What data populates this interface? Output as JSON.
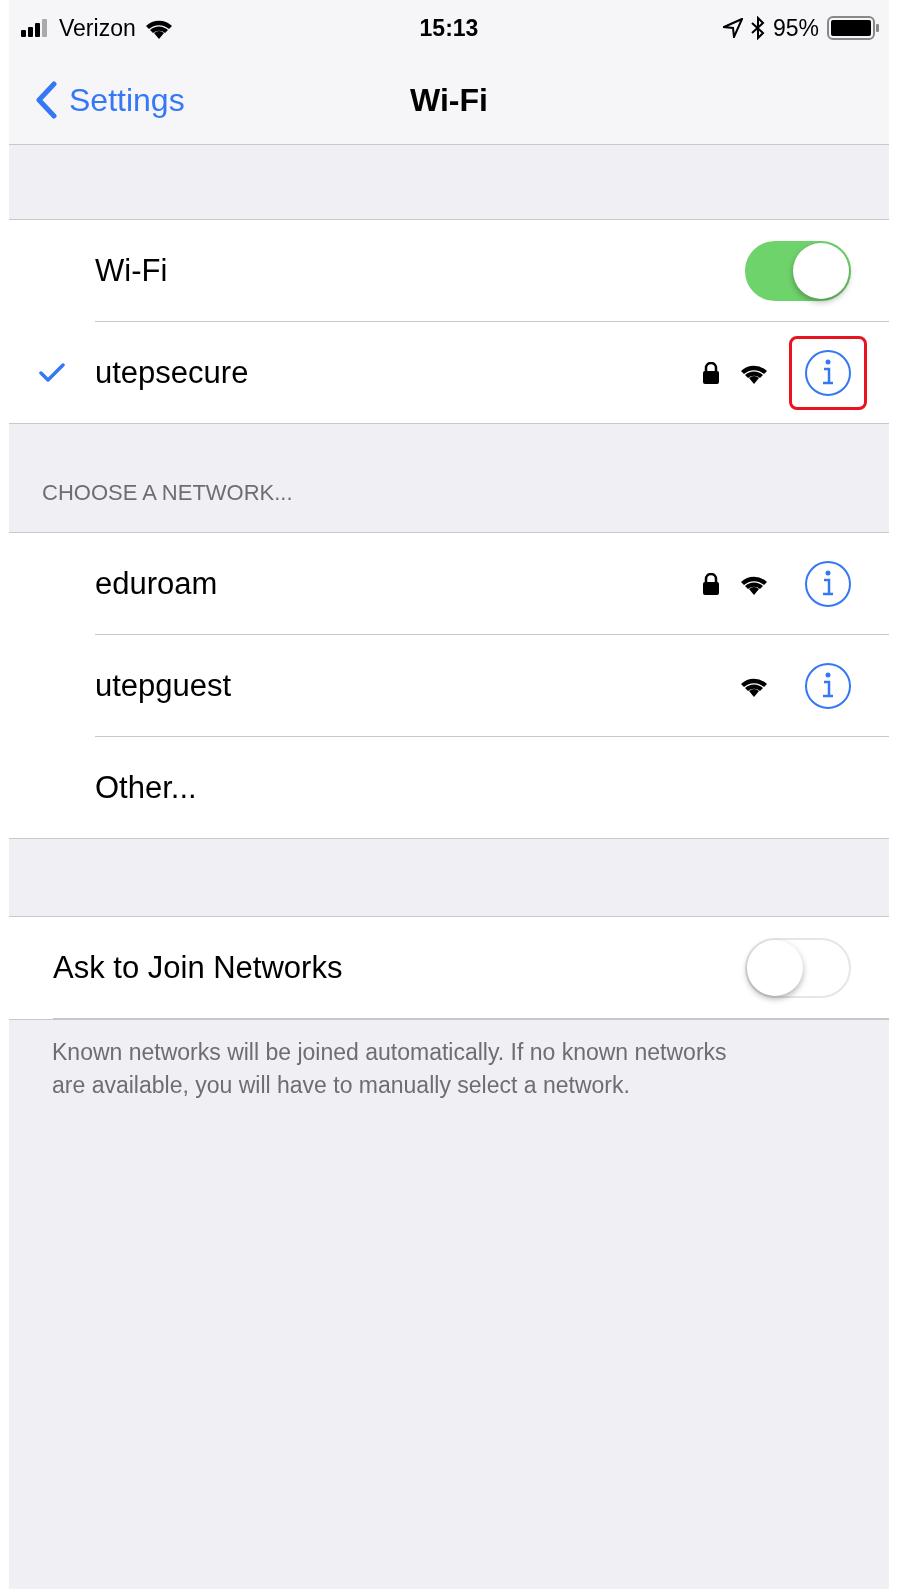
{
  "status_bar": {
    "carrier": "Verizon",
    "time": "15:13",
    "battery": "95%"
  },
  "nav": {
    "back": "Settings",
    "title": "Wi-Fi"
  },
  "wifi_toggle": {
    "label": "Wi-Fi",
    "on": true
  },
  "connected": {
    "name": "utepsecure",
    "checked": true,
    "locked": true,
    "highlighted": true
  },
  "section_header": "CHOOSE A NETWORK...",
  "networks": [
    {
      "kind": "network",
      "name": "eduroam",
      "locked": true
    },
    {
      "kind": "network",
      "name": "utepguest",
      "locked": false
    },
    {
      "kind": "other",
      "name": "Other..."
    }
  ],
  "ask_to_join": {
    "label": "Ask to Join Networks",
    "on": false
  },
  "footer": "Known networks will be joined automatically. If no known networks are available, you will have to manually select a network."
}
